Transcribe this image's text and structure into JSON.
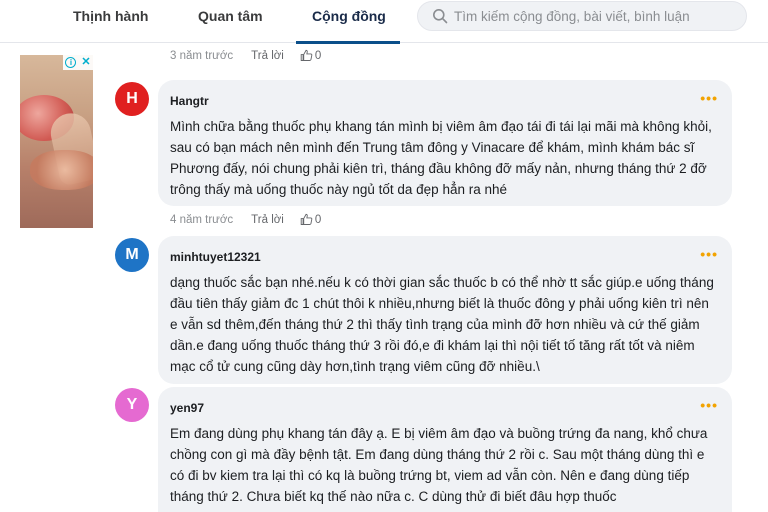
{
  "nav": {
    "tabs": [
      {
        "label": "Thịnh hành"
      },
      {
        "label": "Quan tâm"
      },
      {
        "label": "Cộng đồng"
      }
    ],
    "search_placeholder": "Tìm kiếm cộng đồng, bài viết, bình luận"
  },
  "colors": {
    "accent": "#0b4f8a",
    "more_dots": "#f2a300",
    "bubble_bg": "#f0f2f5"
  },
  "top_meta": {
    "time": "3 năm trước",
    "reply": "Trả lời",
    "likes": "0"
  },
  "comments": [
    {
      "initial": "H",
      "avatar_color": "#e02020",
      "author": "Hangtr",
      "text": "Mình chữa bằng thuốc phụ khang tán mình bị viêm âm đạo tái đi tái lại mãi mà không khỏi, sau có bạn mách nên mình đến Trung tâm đông y Vinacare để khám, mình khám bác sĩ Phương đấy, nói chung phải kiên trì, tháng đầu không đỡ mấy nản, nhưng tháng thứ 2 đỡ trông thấy mà uống thuốc này ngủ tốt da đẹp hẳn ra nhé",
      "time": "4 năm trước",
      "reply": "Trả lời",
      "likes": "0"
    },
    {
      "initial": "M",
      "avatar_color": "#1e74c6",
      "author": "minhtuyet12321",
      "text": "dạng thuốc sắc bạn nhé.nếu k có thời gian sắc thuốc b có thể nhờ tt sắc giúp.e uống tháng đầu tiên thấy giảm đc 1 chút thôi k nhiều,nhưng biết là thuốc đông y phải uống kiên trì nên e vẫn sd thêm,đến tháng thứ 2 thì thấy tình trạng của mình đỡ hơn nhiều và cứ thế giảm dần.e đang uống thuốc tháng thứ 3 rồi đó,e đi khám lại thì nội tiết tố tăng rất tốt và niêm mạc cổ tử cung cũng dày hơn,tình trạng viêm cũng đỡ nhiều.\\"
    },
    {
      "initial": "Y",
      "avatar_color": "#e56ad1",
      "author": "yen97",
      "text": "Em đang dùng phụ khang tán đây ạ. E bị viêm âm đạo và buồng trứng đa nang, khổ chưa chồng con gì mà đầy bệnh tật. Em đang dùng tháng thứ 2 rồi c. Sau một tháng dùng thì e có đi bv kiem tra lại thì có kq là buồng trứng bt, viem ad vẫn còn. Nên e đang dùng tiếp tháng thứ 2. Chưa biết kq thế nào nữa c. C dùng thử đi biết đâu hợp thuốc"
    }
  ]
}
